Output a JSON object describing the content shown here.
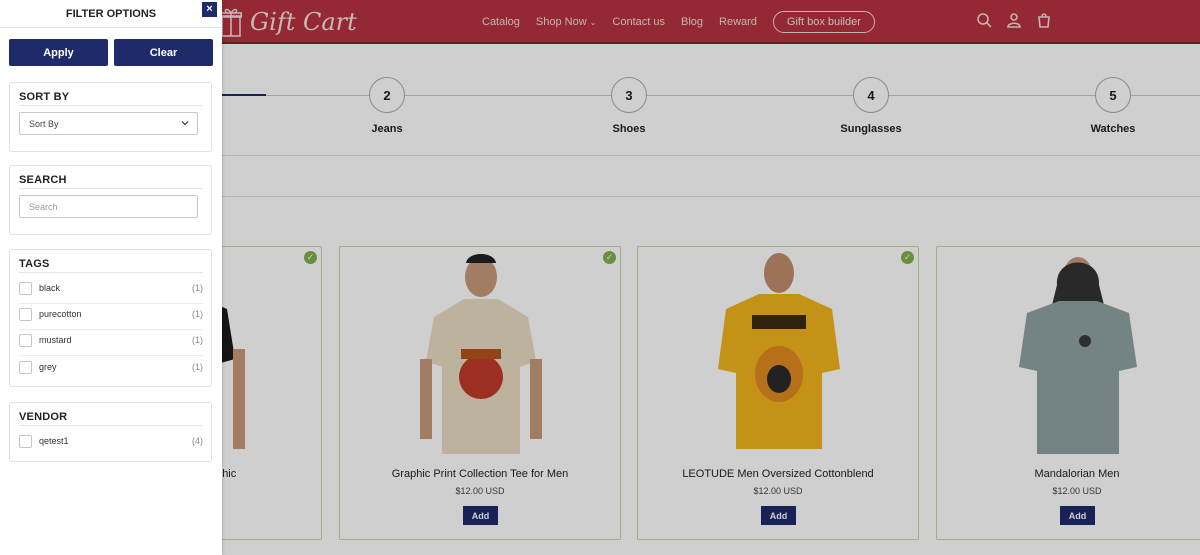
{
  "header": {
    "logo_text": "Gift Cart",
    "nav": [
      "Catalog",
      "Shop Now",
      "Contact us",
      "Blog",
      "Reward"
    ],
    "gift_box_builder": "Gift box builder"
  },
  "steps": [
    {
      "number": "2",
      "label": "Jeans"
    },
    {
      "number": "3",
      "label": "Shoes"
    },
    {
      "number": "4",
      "label": "Sunglasses"
    },
    {
      "number": "5",
      "label": "Watches"
    }
  ],
  "products": [
    {
      "title": "Graphic",
      "price": "",
      "add": "",
      "selected": true
    },
    {
      "title": "Graphic Print Collection Tee for Men",
      "price": "$12.00 USD",
      "add": "Add",
      "selected": true
    },
    {
      "title": "LEOTUDE Men Oversized Cottonblend",
      "price": "$12.00 USD",
      "add": "Add",
      "selected": true
    },
    {
      "title": "Mandalorian Men",
      "price": "$12.00 USD",
      "add": "Add",
      "selected": false
    }
  ],
  "filter": {
    "title": "FILTER OPTIONS",
    "close": "×",
    "apply": "Apply",
    "clear": "Clear",
    "sort": {
      "title": "SORT BY",
      "selected": "Sort By"
    },
    "search": {
      "title": "SEARCH",
      "placeholder": "Search"
    },
    "tags": {
      "title": "TAGS",
      "items": [
        {
          "label": "black",
          "count": "(1)"
        },
        {
          "label": "purecotton",
          "count": "(1)"
        },
        {
          "label": "mustard",
          "count": "(1)"
        },
        {
          "label": "grey",
          "count": "(1)"
        }
      ]
    },
    "vendor": {
      "title": "VENDOR",
      "items": [
        {
          "label": "qetest1",
          "count": "(4)"
        }
      ]
    }
  },
  "colors": {
    "header_bg": "#b7323f",
    "primary_button": "#1f2a6b",
    "check_green": "#7fb04b",
    "card_border": "#c7d9a3"
  }
}
